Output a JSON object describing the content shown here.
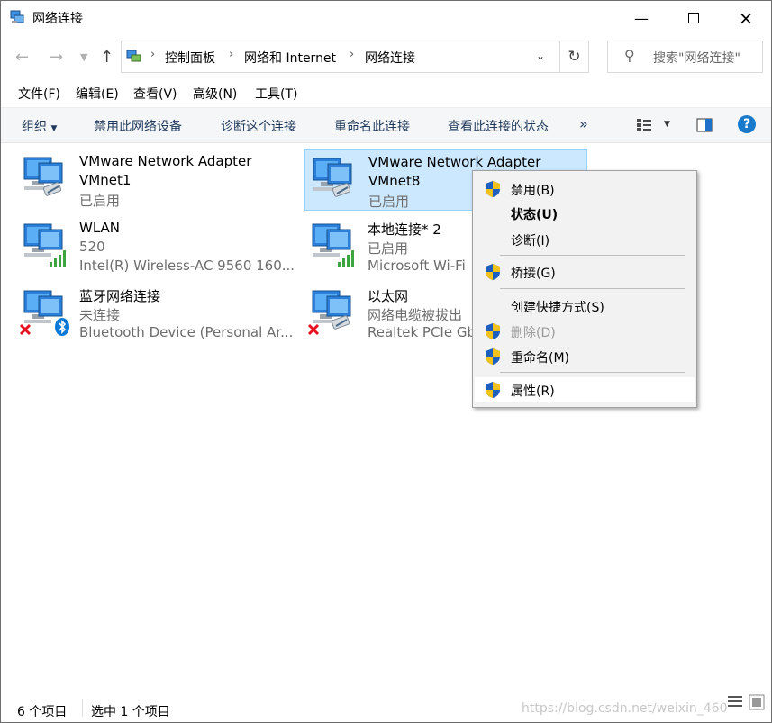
{
  "window": {
    "title": "网络连接"
  },
  "address": {
    "crumbs": [
      "控制面板",
      "网络和 Internet",
      "网络连接"
    ]
  },
  "search": {
    "placeholder": "搜索\"网络连接\""
  },
  "menu": [
    "文件(F)",
    "编辑(E)",
    "查看(V)",
    "高级(N)",
    "工具(T)"
  ],
  "commands": {
    "organize": "组织",
    "disable": "禁用此网络设备",
    "diagnose": "诊断这个连接",
    "rename": "重命名此连接",
    "status": "查看此连接的状态",
    "more": "»"
  },
  "connections": [
    {
      "name": "VMware Network Adapter",
      "line2": "VMnet1",
      "line3": "已启用",
      "icon": "network-adapter-icon",
      "selected": false
    },
    {
      "name": "VMware Network Adapter",
      "line2": "VMnet8",
      "line3": "已启用",
      "icon": "network-adapter-icon",
      "selected": true
    },
    {
      "name": "WLAN",
      "line2": "520",
      "line3": "Intel(R) Wireless-AC 9560 160...",
      "icon": "wifi-adapter-icon",
      "selected": false
    },
    {
      "name": "本地连接* 2",
      "line2": "已启用",
      "line3": "Microsoft Wi-Fi",
      "icon": "wifi-adapter-icon",
      "selected": false
    },
    {
      "name": "蓝牙网络连接",
      "line2": "未连接",
      "line3": "Bluetooth Device (Personal Ar...",
      "icon": "bluetooth-adapter-icon",
      "selected": false
    },
    {
      "name": "以太网",
      "line2": "网络电缆被拔出",
      "line3": "Realtek PCIe Gb",
      "icon": "ethernet-adapter-icon",
      "selected": false
    }
  ],
  "context_menu": [
    {
      "label": "禁用(B)",
      "shield": true,
      "disabled": false,
      "bold": false
    },
    {
      "label": "状态(U)",
      "shield": false,
      "disabled": false,
      "bold": true
    },
    {
      "label": "诊断(I)",
      "shield": false,
      "disabled": false,
      "bold": false
    },
    {
      "label": "桥接(G)",
      "shield": true,
      "disabled": false,
      "bold": false
    },
    {
      "label": "创建快捷方式(S)",
      "shield": false,
      "disabled": false,
      "bold": false
    },
    {
      "label": "删除(D)",
      "shield": true,
      "disabled": true,
      "bold": false
    },
    {
      "label": "重命名(M)",
      "shield": true,
      "disabled": false,
      "bold": false
    },
    {
      "label": "属性(R)",
      "shield": true,
      "disabled": false,
      "bold": false,
      "hover": true
    }
  ],
  "status": {
    "count": "6 个项目",
    "selected": "选中 1 个项目"
  },
  "watermark": "https://blog.csdn.net/weixin_460",
  "colors": {
    "selection": "#cce8ff",
    "selection_border": "#99d1ff",
    "command_text": "#1e395b",
    "help": "#1979ca",
    "signal": "#3fa33f",
    "error": "#e81123",
    "bluetooth": "#0a79d6"
  }
}
